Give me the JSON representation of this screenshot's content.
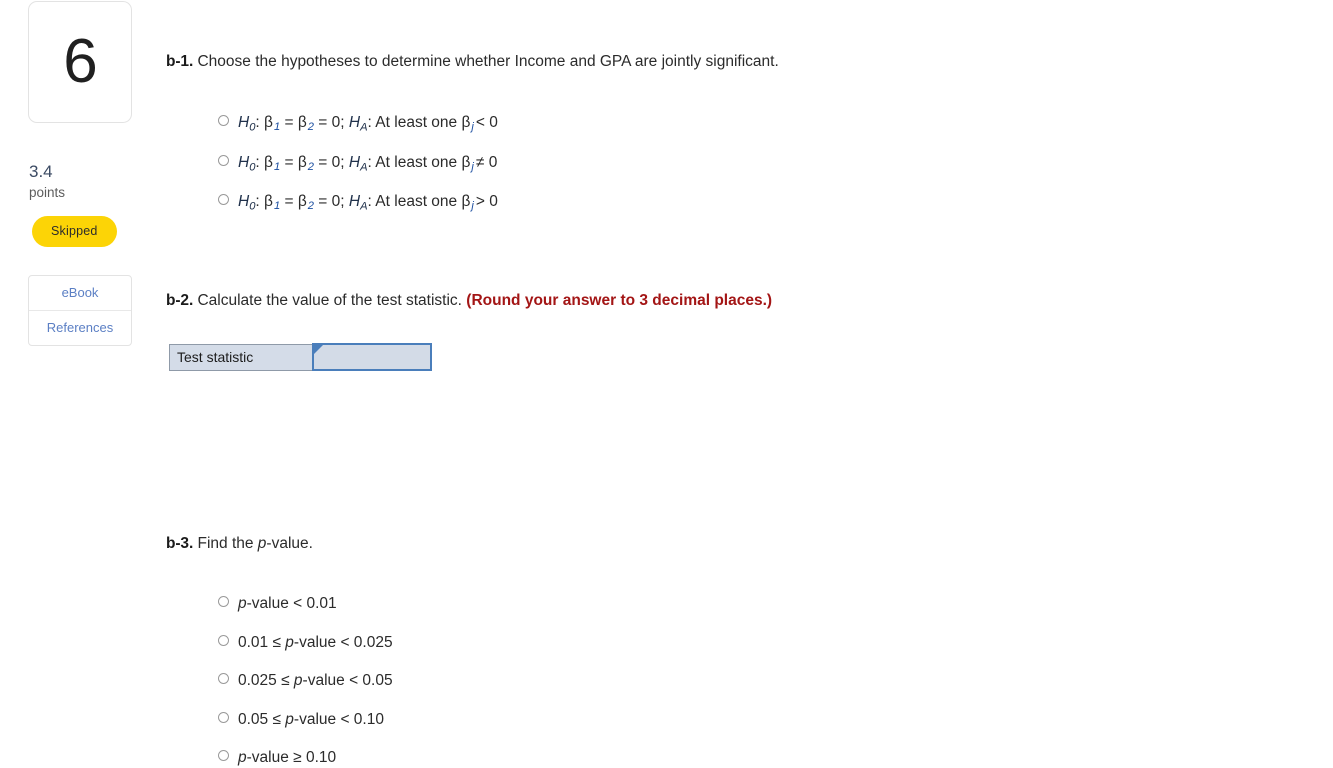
{
  "sidebar": {
    "question_number": "6",
    "points_value": "3.4",
    "points_label": "points",
    "status_badge": "Skipped",
    "resources": [
      {
        "label": "eBook"
      },
      {
        "label": "References"
      }
    ]
  },
  "main": {
    "b1": {
      "tag": "b-1.",
      "prompt": "Choose the hypotheses to determine whether Income and GPA are jointly significant.",
      "options": [
        {
          "null_var": "H",
          "null_sub": "0",
          "null_body": ": β",
          "b1_sub": "1",
          "eq1": " = β",
          "b2_sub": "2",
          "eq2": " = 0; ",
          "alt_var": "H",
          "alt_sub": "A",
          "alt_body": ": At least one β",
          "j_sub": "j",
          "relation": "< 0",
          "plain": "H0: β1 = β2 = 0; HA: At least one βj < 0"
        },
        {
          "null_var": "H",
          "null_sub": "0",
          "null_body": ": β",
          "b1_sub": "1",
          "eq1": " = β",
          "b2_sub": "2",
          "eq2": " = 0; ",
          "alt_var": "H",
          "alt_sub": "A",
          "alt_body": ": At least one β",
          "j_sub": "j",
          "relation": "≠ 0",
          "plain": "H0: β1 = β2 = 0; HA: At least one βj ≠ 0"
        },
        {
          "null_var": "H",
          "null_sub": "0",
          "null_body": ": β",
          "b1_sub": "1",
          "eq1": " = β",
          "b2_sub": "2",
          "eq2": " = 0; ",
          "alt_var": "H",
          "alt_sub": "A",
          "alt_body": ": At least one β",
          "j_sub": "j",
          "relation": "> 0",
          "plain": "H0: β1 = β2 = 0; HA: At least one βj > 0"
        }
      ]
    },
    "b2": {
      "tag": "b-2.",
      "prompt": "Calculate the value of the test statistic.",
      "round_note": "(Round your answer to 3 decimal places.)",
      "row_label": "Test statistic",
      "input_value": "",
      "input_placeholder": ""
    },
    "b3": {
      "tag": "b-3.",
      "prompt_pre": "Find the ",
      "prompt_ital": "p",
      "prompt_post": "-value.",
      "options": [
        {
          "pre": "",
          "ital": "p",
          "post": "-value < 0.01"
        },
        {
          "pre": "0.01 ≤ ",
          "ital": "p",
          "post": "-value < 0.025"
        },
        {
          "pre": "0.025 ≤ ",
          "ital": "p",
          "post": "-value < 0.05"
        },
        {
          "pre": "0.05 ≤ ",
          "ital": "p",
          "post": "-value < 0.10"
        },
        {
          "pre": "",
          "ital": "p",
          "post": "-value ≥ 0.10"
        }
      ]
    }
  },
  "colors": {
    "badge_yellow": "#fcd406",
    "link_blue": "#5b7fc4",
    "note_red": "#a31515",
    "input_border_blue": "#4a7ebb",
    "input_fill": "#d3dbe7",
    "label_fill": "#d4dce8"
  }
}
